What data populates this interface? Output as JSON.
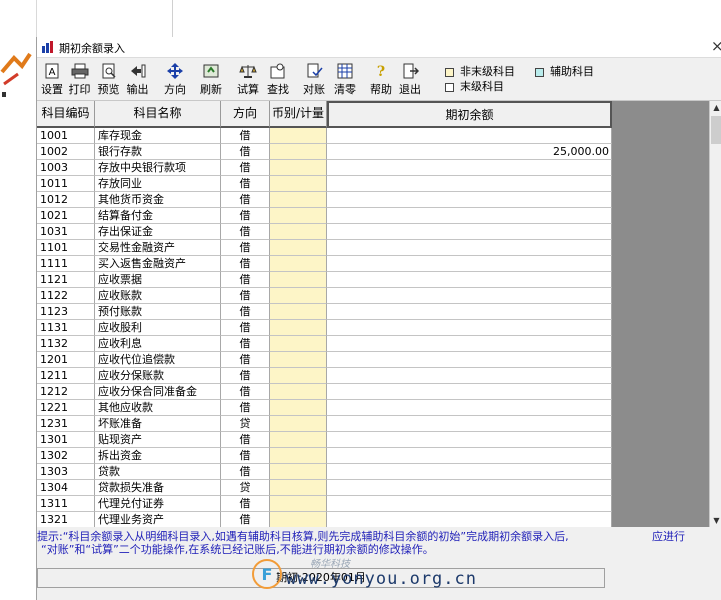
{
  "window": {
    "title": "期初余额录入",
    "close_glyph": "×"
  },
  "toolbar": [
    {
      "key": "setup",
      "label": "设置",
      "icon": "setup-icon"
    },
    {
      "key": "print",
      "label": "打印",
      "icon": "printer-icon"
    },
    {
      "key": "preview",
      "label": "预览",
      "icon": "preview-icon"
    },
    {
      "key": "export",
      "label": "输出",
      "icon": "export-icon"
    },
    {
      "key": "direction",
      "label": "方向",
      "icon": "direction-icon"
    },
    {
      "key": "refresh",
      "label": "刷新",
      "icon": "refresh-icon"
    },
    {
      "key": "calculate",
      "label": "试算",
      "icon": "scale-icon"
    },
    {
      "key": "find",
      "label": "查找",
      "icon": "find-icon"
    },
    {
      "key": "reconcile",
      "label": "对账",
      "icon": "reconcile-icon"
    },
    {
      "key": "clear",
      "label": "清零",
      "icon": "clear-icon"
    },
    {
      "key": "help",
      "label": "帮助",
      "icon": "help-icon"
    },
    {
      "key": "exit",
      "label": "退出",
      "icon": "exit-icon"
    }
  ],
  "legend": {
    "non_leaf": "非末级科目",
    "auxiliary": "辅助科目",
    "leaf": "末级科目"
  },
  "table": {
    "headers": {
      "code": "科目编码",
      "name": "科目名称",
      "direction": "方向",
      "currency": "币别/计量",
      "balance": "期初余额"
    },
    "rows": [
      {
        "code": "1001",
        "name": "库存现金",
        "dir": "借",
        "bal": ""
      },
      {
        "code": "1002",
        "name": "银行存款",
        "dir": "借",
        "bal": "25,000.00"
      },
      {
        "code": "1003",
        "name": "存放中央银行款项",
        "dir": "借",
        "bal": ""
      },
      {
        "code": "1011",
        "name": "存放同业",
        "dir": "借",
        "bal": ""
      },
      {
        "code": "1012",
        "name": "其他货币资金",
        "dir": "借",
        "bal": ""
      },
      {
        "code": "1021",
        "name": "结算备付金",
        "dir": "借",
        "bal": ""
      },
      {
        "code": "1031",
        "name": "存出保证金",
        "dir": "借",
        "bal": ""
      },
      {
        "code": "1101",
        "name": "交易性金融资产",
        "dir": "借",
        "bal": ""
      },
      {
        "code": "1111",
        "name": "买入返售金融资产",
        "dir": "借",
        "bal": ""
      },
      {
        "code": "1121",
        "name": "应收票据",
        "dir": "借",
        "bal": ""
      },
      {
        "code": "1122",
        "name": "应收账款",
        "dir": "借",
        "bal": ""
      },
      {
        "code": "1123",
        "name": "预付账款",
        "dir": "借",
        "bal": ""
      },
      {
        "code": "1131",
        "name": "应收股利",
        "dir": "借",
        "bal": ""
      },
      {
        "code": "1132",
        "name": "应收利息",
        "dir": "借",
        "bal": ""
      },
      {
        "code": "1201",
        "name": "应收代位追偿款",
        "dir": "借",
        "bal": ""
      },
      {
        "code": "1211",
        "name": "应收分保账款",
        "dir": "借",
        "bal": ""
      },
      {
        "code": "1212",
        "name": "应收分保合同准备金",
        "dir": "借",
        "bal": ""
      },
      {
        "code": "1221",
        "name": "其他应收款",
        "dir": "借",
        "bal": ""
      },
      {
        "code": "1231",
        "name": "坏账准备",
        "dir": "贷",
        "bal": ""
      },
      {
        "code": "1301",
        "name": "贴现资产",
        "dir": "借",
        "bal": ""
      },
      {
        "code": "1302",
        "name": "拆出资金",
        "dir": "借",
        "bal": ""
      },
      {
        "code": "1303",
        "name": "贷款",
        "dir": "借",
        "bal": ""
      },
      {
        "code": "1304",
        "name": "贷款损失准备",
        "dir": "贷",
        "bal": ""
      },
      {
        "code": "1311",
        "name": "代理兑付证券",
        "dir": "借",
        "bal": ""
      },
      {
        "code": "1321",
        "name": "代理业务资产",
        "dir": "借",
        "bal": ""
      }
    ]
  },
  "hint": {
    "line1": "提示:“科目余额录入从明细科目录入,如遇有辅助科目核算,则先完成辅助科目余额的初始”完成期初余额录入后,",
    "line1_tail": "应进行",
    "line2": "“对账”和“试算”二个功能操作,在系统已经记账后,不能进行期初余额的修改操作。"
  },
  "status": {
    "text": "期初:2020年01月"
  },
  "watermark": {
    "text": "www.yonyou.org.cn",
    "brand": "畅华科技"
  },
  "colors": {
    "hint": "#1f1fb8",
    "currency_column": "#fdf5c7",
    "gray_area": "#8c8c8c"
  }
}
